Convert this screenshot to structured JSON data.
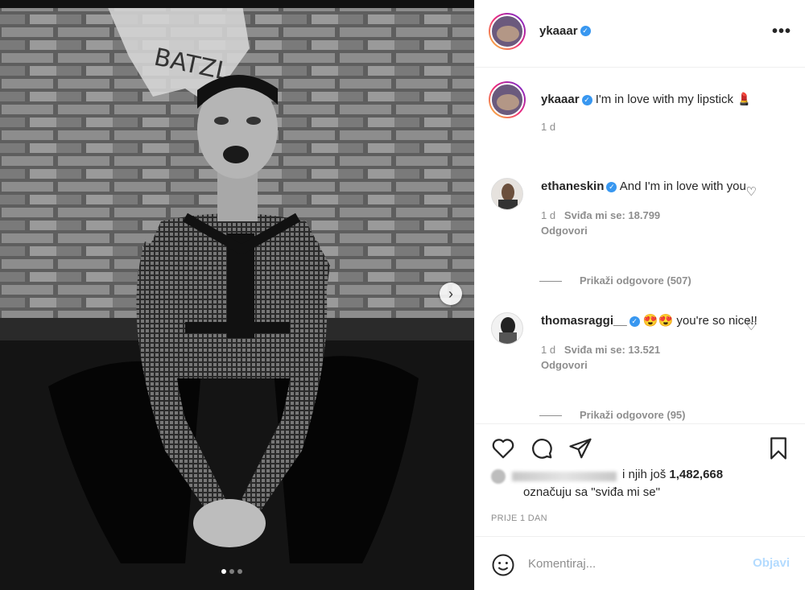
{
  "photo": {
    "graffiti_text": "BATZL",
    "next_icon": "chevron-right-icon",
    "carousel": {
      "count": 3,
      "active": 1
    }
  },
  "header": {
    "username": "ykaaar",
    "verified_icon": "verified-badge-icon",
    "more_label": "•••"
  },
  "caption": {
    "username": "ykaaar",
    "text": "I'm in love with my lipstick",
    "emoji": "💄",
    "time": "1 d"
  },
  "comments": [
    {
      "username": "ethaneskin",
      "text": "And I'm in love with you",
      "time": "1 d",
      "likes": "Sviđa mi se: 18.799",
      "reply_label": "Odgovori",
      "view_replies": "Prikaži odgovore (507)"
    },
    {
      "username": "thomasraggi__",
      "text": "😍😍 you're so nice!!",
      "time": "1 d",
      "likes": "Sviđa mi se: 13.521",
      "reply_label": "Odgovori",
      "view_replies": "Prikaži odgovore (95)"
    }
  ],
  "likes": {
    "prefix": "i njih još",
    "count": "1,482,668",
    "suffix": "označuju sa \"sviđa mi se\""
  },
  "timestamp": "PRIJE 1 DAN",
  "comment_box": {
    "placeholder": "Komentiraj...",
    "post_label": "Objavi"
  },
  "colors": {
    "verified": "#3897f0",
    "post_disabled": "#b3dbff",
    "muted": "#8e8e8e"
  }
}
